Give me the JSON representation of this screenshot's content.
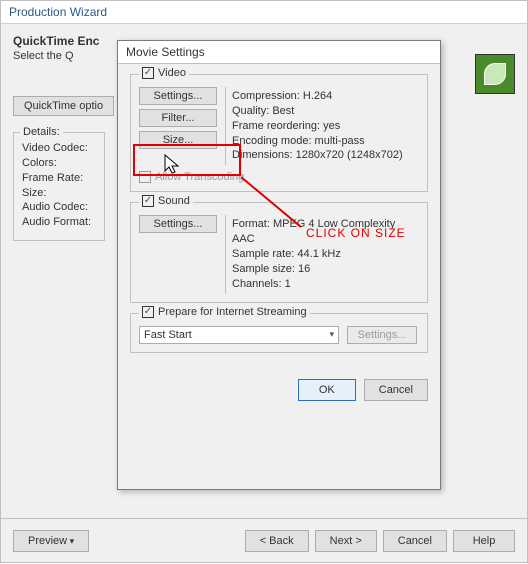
{
  "outer": {
    "title": "Production Wizard",
    "heading": "QuickTime Enc",
    "subheading": "Select the Q",
    "options_btn": "QuickTime optio",
    "preview": "Preview",
    "back": "< Back",
    "next": "Next >",
    "cancel": "Cancel",
    "help": "Help"
  },
  "details": {
    "legend": "Details:",
    "lines": {
      "l0": "Video Codec:",
      "l1": "Colors:",
      "l2": "Frame Rate:",
      "l3": "Size:",
      "l4": "Audio Codec:",
      "l5": "Audio Format:"
    }
  },
  "dialog": {
    "title": "Movie Settings",
    "video": {
      "legend": "Video",
      "settings": "Settings...",
      "filter": "Filter...",
      "size": "Size...",
      "info0": "Compression: H.264",
      "info1": "Quality: Best",
      "info2": "Frame reordering: yes",
      "info3": "Encoding mode: multi-pass",
      "info4": "Dimensions: 1280x720 (1248x702)",
      "transcoding": "Allow Transcoding"
    },
    "sound": {
      "legend": "Sound",
      "settings": "Settings...",
      "info0": "Format: MPEG 4 Low Complexity AAC",
      "info1": "Sample rate: 44.1 kHz",
      "info2": "Sample size: 16",
      "info3": "Channels: 1"
    },
    "streaming": {
      "legend": "Prepare for Internet Streaming",
      "select_value": "Fast Start",
      "settings": "Settings..."
    },
    "ok": "OK",
    "cancel": "Cancel"
  },
  "annotation": {
    "text": "CLICK  ON SIZE"
  }
}
